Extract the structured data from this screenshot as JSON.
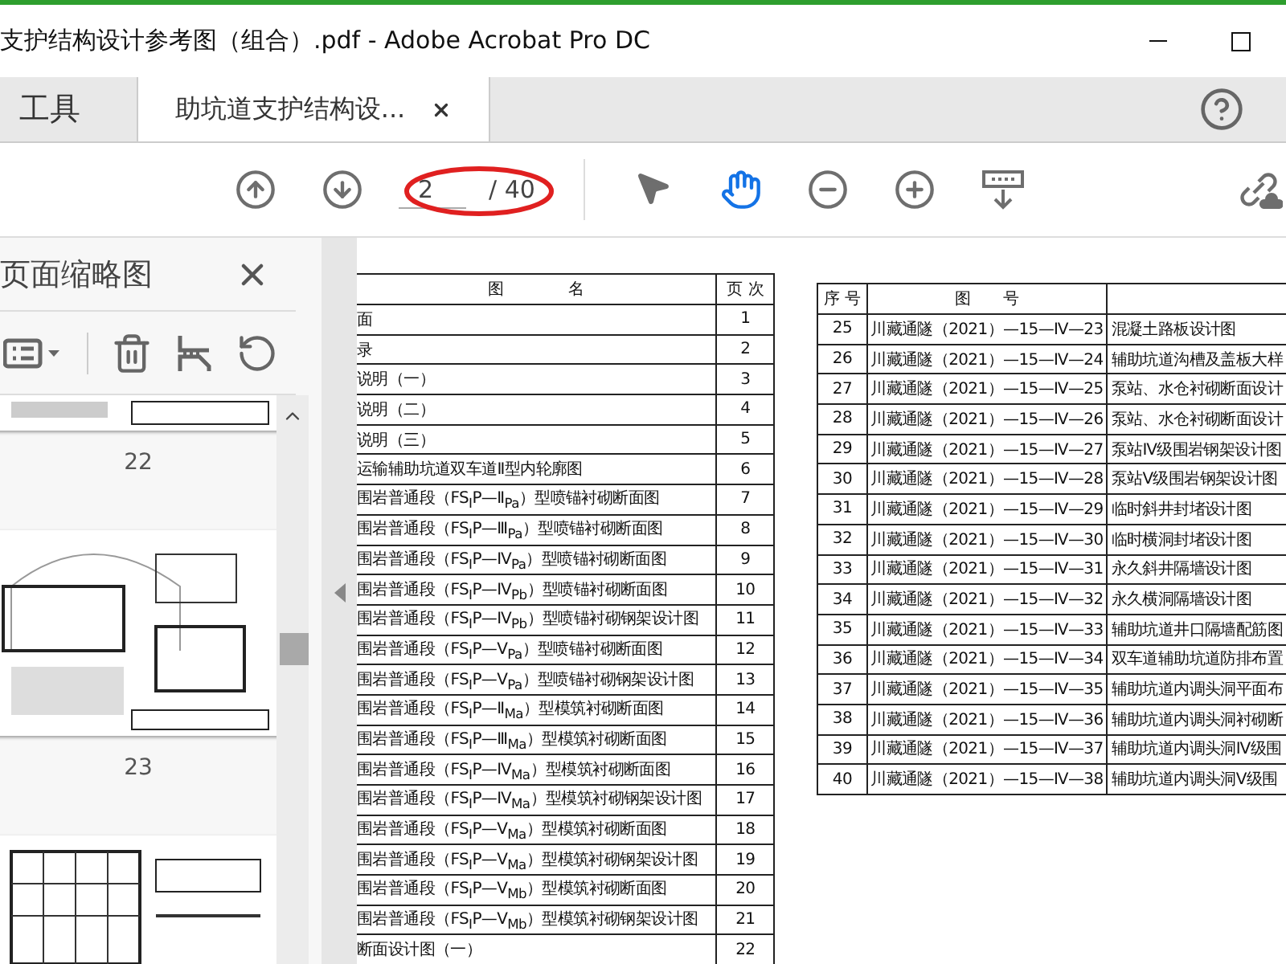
{
  "window": {
    "title": "支护结构设计参考图（组合）.pdf - Adobe Acrobat Pro DC"
  },
  "tabs": [
    {
      "label": "工具",
      "selected": false
    },
    {
      "label": "助坑道支护结构设...",
      "selected": true
    }
  ],
  "toolbar": {
    "page_input": "2",
    "page_total": "/ 40",
    "hand_tool_selected": true
  },
  "sidebar": {
    "title": "页面缩略图",
    "thumbnails": [
      {
        "label": "22",
        "kind": "strip"
      },
      {
        "label": "23",
        "kind": "full"
      },
      {
        "kind": "partial"
      }
    ]
  },
  "left_table": {
    "columns": [
      "图　　　　名",
      "页 次"
    ],
    "rows": [
      {
        "name": "面",
        "page": "1"
      },
      {
        "name": "录",
        "page": "2"
      },
      {
        "name": "说明（一）",
        "page": "3"
      },
      {
        "name": "说明（二）",
        "page": "4"
      },
      {
        "name": "说明（三）",
        "page": "5"
      },
      {
        "name": "运输辅助坑道双车道Ⅱ型内轮廓图",
        "page": "6"
      },
      {
        "name": "围岩普通段（FS$_{Ⅰ}$P—Ⅱ$_{Pa}$）型喷锚衬砌断面图",
        "page": "7"
      },
      {
        "name": "围岩普通段（FS$_{Ⅰ}$P—Ⅲ$_{Pa}$）型喷锚衬砌断面图",
        "page": "8"
      },
      {
        "name": "围岩普通段（FS$_{Ⅰ}$P—Ⅳ$_{Pa}$）型喷锚衬砌断面图",
        "page": "9"
      },
      {
        "name": "围岩普通段（FS$_{Ⅰ}$P—Ⅳ$_{Pb}$）型喷锚衬砌断面图",
        "page": "10"
      },
      {
        "name": "围岩普通段（FS$_{Ⅰ}$P—Ⅳ$_{Pb}$）型喷锚衬砌钢架设计图",
        "page": "11"
      },
      {
        "name": "围岩普通段（FS$_{Ⅰ}$P—Ⅴ$_{Pa}$）型喷锚衬砌断面图",
        "page": "12"
      },
      {
        "name": "围岩普通段（FS$_{Ⅰ}$P—Ⅴ$_{Pa}$）型喷锚衬砌钢架设计图",
        "page": "13"
      },
      {
        "name": "围岩普通段（FS$_{Ⅰ}$P—Ⅱ$_{Ma}$）型模筑衬砌断面图",
        "page": "14"
      },
      {
        "name": "围岩普通段（FS$_{Ⅰ}$P—Ⅲ$_{Ma}$）型模筑衬砌断面图",
        "page": "15"
      },
      {
        "name": "围岩普通段（FS$_{Ⅰ}$P—Ⅳ$_{Ma}$）型模筑衬砌断面图",
        "page": "16"
      },
      {
        "name": "围岩普通段（FS$_{Ⅰ}$P—Ⅳ$_{Ma}$）型模筑衬砌钢架设计图",
        "page": "17"
      },
      {
        "name": "围岩普通段（FS$_{Ⅰ}$P—Ⅴ$_{Ma}$）型模筑衬砌断面图",
        "page": "18"
      },
      {
        "name": "围岩普通段（FS$_{Ⅰ}$P—Ⅴ$_{Ma}$）型模筑衬砌钢架设计图",
        "page": "19"
      },
      {
        "name": "围岩普通段（FS$_{Ⅰ}$P—Ⅴ$_{Mb}$）型模筑衬砌断面图",
        "page": "20"
      },
      {
        "name": "围岩普通段（FS$_{Ⅰ}$P—Ⅴ$_{Mb}$）型模筑衬砌钢架设计图",
        "page": "21"
      },
      {
        "name": "断面设计图（一）",
        "page": "22"
      }
    ]
  },
  "right_table": {
    "columns": [
      "序 号",
      "图　　号"
    ],
    "rows": [
      {
        "no": "25",
        "code": "川藏通隧（2021）—15—Ⅳ—23",
        "name": "混凝土路板设计图"
      },
      {
        "no": "26",
        "code": "川藏通隧（2021）—15—Ⅳ—24",
        "name": "辅助坑道沟槽及盖板大样"
      },
      {
        "no": "27",
        "code": "川藏通隧（2021）—15—Ⅳ—25",
        "name": "泵站、水仓衬砌断面设计"
      },
      {
        "no": "28",
        "code": "川藏通隧（2021）—15—Ⅳ—26",
        "name": "泵站、水仓衬砌断面设计"
      },
      {
        "no": "29",
        "code": "川藏通隧（2021）—15—Ⅳ—27",
        "name": "泵站Ⅳ级围岩钢架设计图"
      },
      {
        "no": "30",
        "code": "川藏通隧（2021）—15—Ⅳ—28",
        "name": "泵站Ⅴ级围岩钢架设计图"
      },
      {
        "no": "31",
        "code": "川藏通隧（2021）—15—Ⅳ—29",
        "name": "临时斜井封堵设计图"
      },
      {
        "no": "32",
        "code": "川藏通隧（2021）—15—Ⅳ—30",
        "name": "临时横洞封堵设计图"
      },
      {
        "no": "33",
        "code": "川藏通隧（2021）—15—Ⅳ—31",
        "name": "永久斜井隔墙设计图"
      },
      {
        "no": "34",
        "code": "川藏通隧（2021）—15—Ⅳ—32",
        "name": "永久横洞隔墙设计图"
      },
      {
        "no": "35",
        "code": "川藏通隧（2021）—15—Ⅳ—33",
        "name": "辅助坑道井口隔墙配筋图"
      },
      {
        "no": "36",
        "code": "川藏通隧（2021）—15—Ⅳ—34",
        "name": "双车道辅助坑道防排布置"
      },
      {
        "no": "37",
        "code": "川藏通隧（2021）—15—Ⅳ—35",
        "name": "辅助坑道内调头洞平面布"
      },
      {
        "no": "38",
        "code": "川藏通隧（2021）—15—Ⅳ—36",
        "name": "辅助坑道内调头洞衬砌断"
      },
      {
        "no": "39",
        "code": "川藏通隧（2021）—15—Ⅳ—37",
        "name": "辅助坑道内调头洞Ⅳ级围"
      },
      {
        "no": "40",
        "code": "川藏通隧（2021）—15—Ⅳ—38",
        "name": "辅助坑道内调头洞Ⅴ级围"
      }
    ]
  }
}
